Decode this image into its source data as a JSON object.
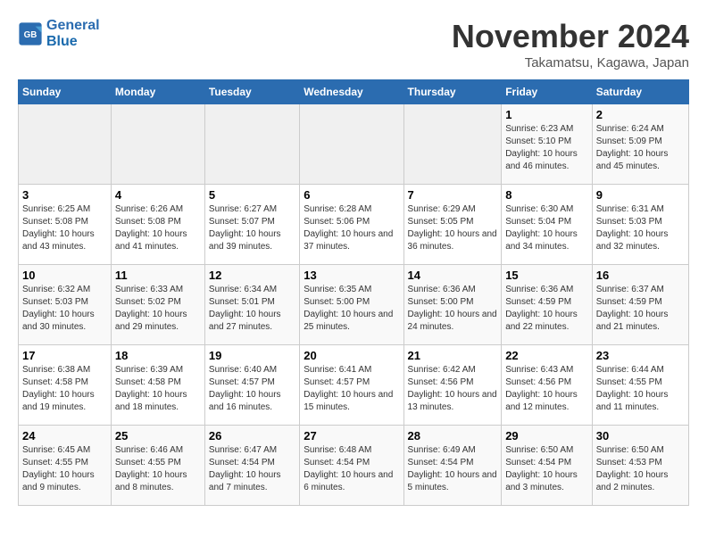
{
  "logo": {
    "text1": "General",
    "text2": "Blue"
  },
  "header": {
    "month": "November 2024",
    "location": "Takamatsu, Kagawa, Japan"
  },
  "weekdays": [
    "Sunday",
    "Monday",
    "Tuesday",
    "Wednesday",
    "Thursday",
    "Friday",
    "Saturday"
  ],
  "weeks": [
    [
      {
        "day": "",
        "empty": true
      },
      {
        "day": "",
        "empty": true
      },
      {
        "day": "",
        "empty": true
      },
      {
        "day": "",
        "empty": true
      },
      {
        "day": "",
        "empty": true
      },
      {
        "day": "1",
        "sunrise": "6:23 AM",
        "sunset": "5:10 PM",
        "daylight": "10 hours and 46 minutes."
      },
      {
        "day": "2",
        "sunrise": "6:24 AM",
        "sunset": "5:09 PM",
        "daylight": "10 hours and 45 minutes."
      }
    ],
    [
      {
        "day": "3",
        "sunrise": "6:25 AM",
        "sunset": "5:08 PM",
        "daylight": "10 hours and 43 minutes."
      },
      {
        "day": "4",
        "sunrise": "6:26 AM",
        "sunset": "5:08 PM",
        "daylight": "10 hours and 41 minutes."
      },
      {
        "day": "5",
        "sunrise": "6:27 AM",
        "sunset": "5:07 PM",
        "daylight": "10 hours and 39 minutes."
      },
      {
        "day": "6",
        "sunrise": "6:28 AM",
        "sunset": "5:06 PM",
        "daylight": "10 hours and 37 minutes."
      },
      {
        "day": "7",
        "sunrise": "6:29 AM",
        "sunset": "5:05 PM",
        "daylight": "10 hours and 36 minutes."
      },
      {
        "day": "8",
        "sunrise": "6:30 AM",
        "sunset": "5:04 PM",
        "daylight": "10 hours and 34 minutes."
      },
      {
        "day": "9",
        "sunrise": "6:31 AM",
        "sunset": "5:03 PM",
        "daylight": "10 hours and 32 minutes."
      }
    ],
    [
      {
        "day": "10",
        "sunrise": "6:32 AM",
        "sunset": "5:03 PM",
        "daylight": "10 hours and 30 minutes."
      },
      {
        "day": "11",
        "sunrise": "6:33 AM",
        "sunset": "5:02 PM",
        "daylight": "10 hours and 29 minutes."
      },
      {
        "day": "12",
        "sunrise": "6:34 AM",
        "sunset": "5:01 PM",
        "daylight": "10 hours and 27 minutes."
      },
      {
        "day": "13",
        "sunrise": "6:35 AM",
        "sunset": "5:00 PM",
        "daylight": "10 hours and 25 minutes."
      },
      {
        "day": "14",
        "sunrise": "6:36 AM",
        "sunset": "5:00 PM",
        "daylight": "10 hours and 24 minutes."
      },
      {
        "day": "15",
        "sunrise": "6:36 AM",
        "sunset": "4:59 PM",
        "daylight": "10 hours and 22 minutes."
      },
      {
        "day": "16",
        "sunrise": "6:37 AM",
        "sunset": "4:59 PM",
        "daylight": "10 hours and 21 minutes."
      }
    ],
    [
      {
        "day": "17",
        "sunrise": "6:38 AM",
        "sunset": "4:58 PM",
        "daylight": "10 hours and 19 minutes."
      },
      {
        "day": "18",
        "sunrise": "6:39 AM",
        "sunset": "4:58 PM",
        "daylight": "10 hours and 18 minutes."
      },
      {
        "day": "19",
        "sunrise": "6:40 AM",
        "sunset": "4:57 PM",
        "daylight": "10 hours and 16 minutes."
      },
      {
        "day": "20",
        "sunrise": "6:41 AM",
        "sunset": "4:57 PM",
        "daylight": "10 hours and 15 minutes."
      },
      {
        "day": "21",
        "sunrise": "6:42 AM",
        "sunset": "4:56 PM",
        "daylight": "10 hours and 13 minutes."
      },
      {
        "day": "22",
        "sunrise": "6:43 AM",
        "sunset": "4:56 PM",
        "daylight": "10 hours and 12 minutes."
      },
      {
        "day": "23",
        "sunrise": "6:44 AM",
        "sunset": "4:55 PM",
        "daylight": "10 hours and 11 minutes."
      }
    ],
    [
      {
        "day": "24",
        "sunrise": "6:45 AM",
        "sunset": "4:55 PM",
        "daylight": "10 hours and 9 minutes."
      },
      {
        "day": "25",
        "sunrise": "6:46 AM",
        "sunset": "4:55 PM",
        "daylight": "10 hours and 8 minutes."
      },
      {
        "day": "26",
        "sunrise": "6:47 AM",
        "sunset": "4:54 PM",
        "daylight": "10 hours and 7 minutes."
      },
      {
        "day": "27",
        "sunrise": "6:48 AM",
        "sunset": "4:54 PM",
        "daylight": "10 hours and 6 minutes."
      },
      {
        "day": "28",
        "sunrise": "6:49 AM",
        "sunset": "4:54 PM",
        "daylight": "10 hours and 5 minutes."
      },
      {
        "day": "29",
        "sunrise": "6:50 AM",
        "sunset": "4:54 PM",
        "daylight": "10 hours and 3 minutes."
      },
      {
        "day": "30",
        "sunrise": "6:50 AM",
        "sunset": "4:53 PM",
        "daylight": "10 hours and 2 minutes."
      }
    ]
  ]
}
